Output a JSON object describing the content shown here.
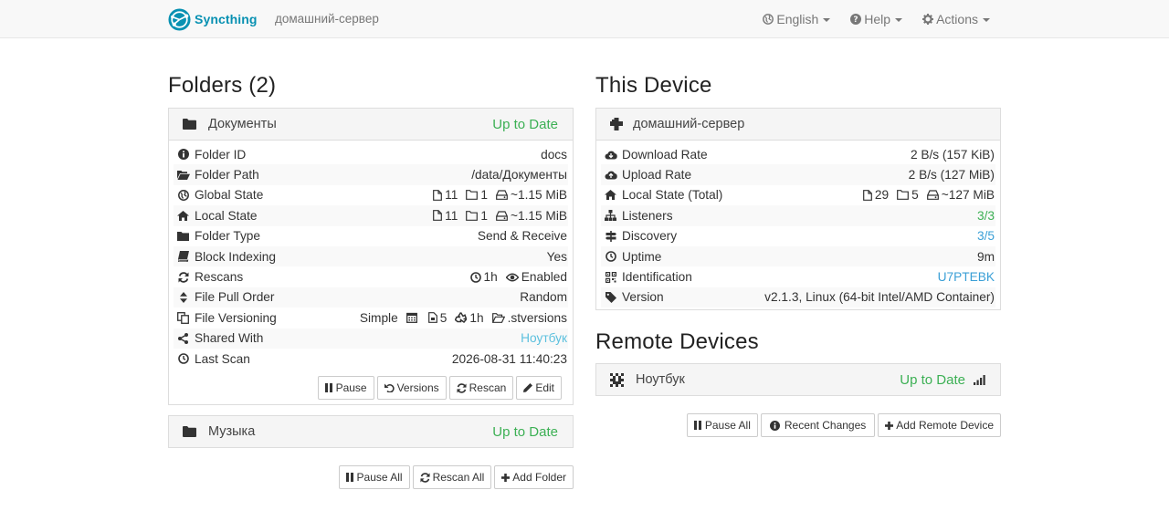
{
  "nav": {
    "brand": "Syncthing",
    "device_name": "домашний-сервер",
    "language": "English",
    "help": "Help",
    "actions": "Actions"
  },
  "folders": {
    "title": "Folders (2)",
    "items": [
      {
        "name": "Документы",
        "status": "Up to Date",
        "rows": {
          "folder_id": {
            "label": "Folder ID",
            "value": "docs"
          },
          "folder_path": {
            "label": "Folder Path",
            "value": "/data/Документы"
          },
          "global_state": {
            "label": "Global State",
            "files": "11",
            "dirs": "1",
            "size": "~1.15 MiB"
          },
          "local_state": {
            "label": "Local State",
            "files": "11",
            "dirs": "1",
            "size": "~1.15 MiB"
          },
          "folder_type": {
            "label": "Folder Type",
            "value": "Send & Receive"
          },
          "block_indexing": {
            "label": "Block Indexing",
            "value": "Yes"
          },
          "rescans": {
            "label": "Rescans",
            "interval": "1h",
            "watch": "Enabled"
          },
          "file_pull_order": {
            "label": "File Pull Order",
            "value": "Random"
          },
          "file_versioning": {
            "label": "File Versioning",
            "type": "Simple",
            "keep": "5",
            "cleanup": "1h",
            "path": ".stversions"
          },
          "shared_with": {
            "label": "Shared With",
            "value": "Ноутбук"
          },
          "last_scan": {
            "label": "Last Scan",
            "value": "2026-08-31 11:40:23"
          }
        },
        "buttons": {
          "pause": "Pause",
          "versions": "Versions",
          "rescan": "Rescan",
          "edit": "Edit"
        }
      },
      {
        "name": "Музыка",
        "status": "Up to Date"
      }
    ],
    "footer": {
      "pause_all": "Pause All",
      "rescan_all": "Rescan All",
      "add_folder": "Add Folder"
    }
  },
  "this_device": {
    "title": "This Device",
    "name": "домашний-сервер",
    "rows": {
      "download_rate": {
        "label": "Download Rate",
        "value": "2 B/s (157 KiB)"
      },
      "upload_rate": {
        "label": "Upload Rate",
        "value": "2 B/s (127 MiB)"
      },
      "local_state": {
        "label": "Local State (Total)",
        "files": "29",
        "dirs": "5",
        "size": "~127 MiB"
      },
      "listeners": {
        "label": "Listeners",
        "value": "3/3"
      },
      "discovery": {
        "label": "Discovery",
        "value": "3/5"
      },
      "uptime": {
        "label": "Uptime",
        "value": "9m"
      },
      "identification": {
        "label": "Identification",
        "value": "U7PTEBK"
      },
      "version": {
        "label": "Version",
        "value": "v2.1.3, Linux (64-bit Intel/AMD Container)"
      }
    }
  },
  "remote_devices": {
    "title": "Remote Devices",
    "items": [
      {
        "name": "Ноутбук",
        "status": "Up to Date"
      }
    ],
    "footer": {
      "pause_all": "Pause All",
      "recent_changes": "Recent Changes",
      "add_remote": "Add Remote Device"
    }
  },
  "colors": {
    "brand": "#0891b2",
    "status_ok": "#3cb054",
    "link": "#5bc0de",
    "navbar_bg": "#f8f8f8",
    "panel_heading_bg": "#f5f5f5"
  },
  "icons": {
    "folder": "folder-icon",
    "info": "info-icon",
    "folder_open": "folder-open-icon",
    "globe": "globe-icon",
    "home": "home-icon",
    "book": "book-icon",
    "refresh": "refresh-icon",
    "sort": "sort-icon",
    "copy": "copy-icon",
    "share": "share-icon",
    "clock": "clock-icon",
    "cloud_download": "cloud-download-icon",
    "cloud_upload": "cloud-upload-icon",
    "sitemap": "sitemap-icon",
    "signpost": "signpost-icon",
    "qrcode": "qrcode-icon",
    "tag": "tag-icon",
    "signal": "signal-icon"
  }
}
